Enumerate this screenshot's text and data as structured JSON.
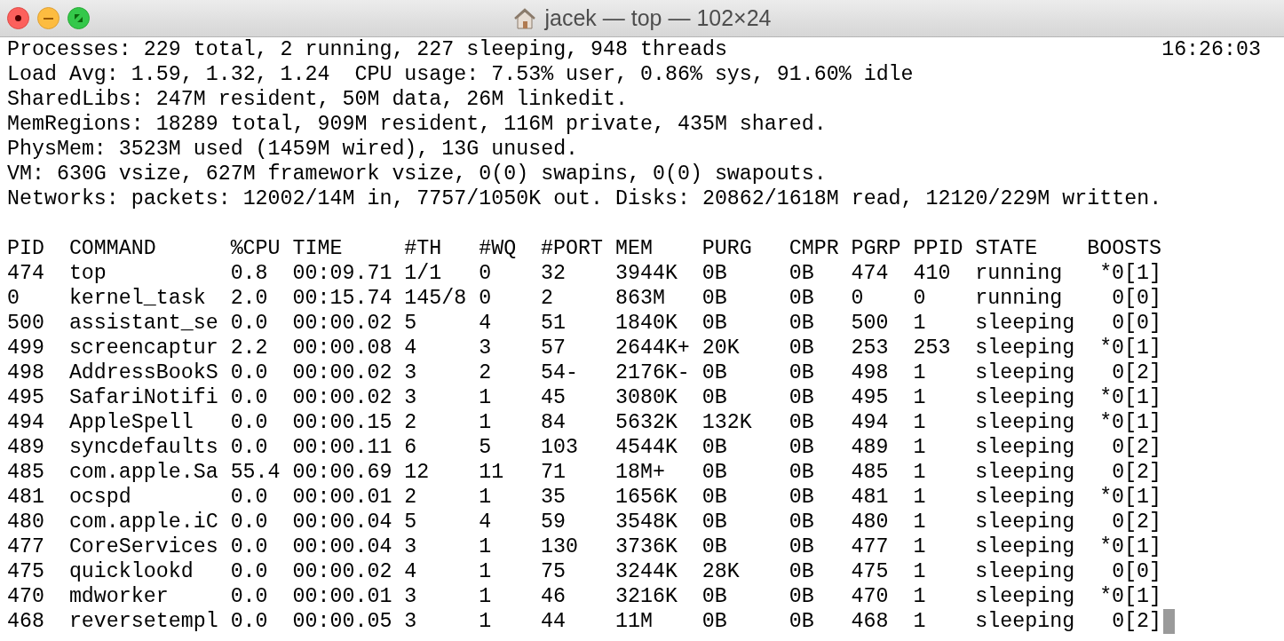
{
  "window": {
    "title": "jacek — top — 102×24"
  },
  "summary": [
    "Processes: 229 total, 2 running, 227 sleeping, 948 threads",
    "Load Avg: 1.59, 1.32, 1.24  CPU usage: 7.53% user, 0.86% sys, 91.60% idle",
    "SharedLibs: 247M resident, 50M data, 26M linkedit.",
    "MemRegions: 18289 total, 909M resident, 116M private, 435M shared.",
    "PhysMem: 3523M used (1459M wired), 13G unused.",
    "VM: 630G vsize, 627M framework vsize, 0(0) swapins, 0(0) swapouts.",
    "Networks: packets: 12002/14M in, 7757/1050K out. Disks: 20862/1618M read, 12120/229M written."
  ],
  "clock": "16:26:03",
  "table": {
    "columns": [
      "PID",
      "COMMAND",
      "%CPU",
      "TIME",
      "#TH",
      "#WQ",
      "#PORT",
      "MEM",
      "PURG",
      "CMPR",
      "PGRP",
      "PPID",
      "STATE",
      "BOOSTS"
    ],
    "rows": [
      [
        "474",
        "top",
        "0.8",
        "00:09.71",
        "1/1",
        "0",
        "32",
        "3944K",
        "0B",
        "0B",
        "474",
        "410",
        "running",
        "*0[1]"
      ],
      [
        "0",
        "kernel_task",
        "2.0",
        "00:15.74",
        "145/8",
        "0",
        "2",
        "863M",
        "0B",
        "0B",
        "0",
        "0",
        "running",
        "0[0]"
      ],
      [
        "500",
        "assistant_se",
        "0.0",
        "00:00.02",
        "5",
        "4",
        "51",
        "1840K",
        "0B",
        "0B",
        "500",
        "1",
        "sleeping",
        "0[0]"
      ],
      [
        "499",
        "screencaptur",
        "2.2",
        "00:00.08",
        "4",
        "3",
        "57",
        "2644K+",
        "20K",
        "0B",
        "253",
        "253",
        "sleeping",
        "*0[1]"
      ],
      [
        "498",
        "AddressBookS",
        "0.0",
        "00:00.02",
        "3",
        "2",
        "54-",
        "2176K-",
        "0B",
        "0B",
        "498",
        "1",
        "sleeping",
        "0[2]"
      ],
      [
        "495",
        "SafariNotifi",
        "0.0",
        "00:00.02",
        "3",
        "1",
        "45",
        "3080K",
        "0B",
        "0B",
        "495",
        "1",
        "sleeping",
        "*0[1]"
      ],
      [
        "494",
        "AppleSpell",
        "0.0",
        "00:00.15",
        "2",
        "1",
        "84",
        "5632K",
        "132K",
        "0B",
        "494",
        "1",
        "sleeping",
        "*0[1]"
      ],
      [
        "489",
        "syncdefaults",
        "0.0",
        "00:00.11",
        "6",
        "5",
        "103",
        "4544K",
        "0B",
        "0B",
        "489",
        "1",
        "sleeping",
        "0[2]"
      ],
      [
        "485",
        "com.apple.Sa",
        "55.4",
        "00:00.69",
        "12",
        "11",
        "71",
        "18M+",
        "0B",
        "0B",
        "485",
        "1",
        "sleeping",
        "0[2]"
      ],
      [
        "481",
        "ocspd",
        "0.0",
        "00:00.01",
        "2",
        "1",
        "35",
        "1656K",
        "0B",
        "0B",
        "481",
        "1",
        "sleeping",
        "*0[1]"
      ],
      [
        "480",
        "com.apple.iC",
        "0.0",
        "00:00.04",
        "5",
        "4",
        "59",
        "3548K",
        "0B",
        "0B",
        "480",
        "1",
        "sleeping",
        "0[2]"
      ],
      [
        "477",
        "CoreServices",
        "0.0",
        "00:00.04",
        "3",
        "1",
        "130",
        "3736K",
        "0B",
        "0B",
        "477",
        "1",
        "sleeping",
        "*0[1]"
      ],
      [
        "475",
        "quicklookd",
        "0.0",
        "00:00.02",
        "4",
        "1",
        "75",
        "3244K",
        "28K",
        "0B",
        "475",
        "1",
        "sleeping",
        "0[0]"
      ],
      [
        "470",
        "mdworker",
        "0.0",
        "00:00.01",
        "3",
        "1",
        "46",
        "3216K",
        "0B",
        "0B",
        "470",
        "1",
        "sleeping",
        "*0[1]"
      ],
      [
        "468",
        "reversetempl",
        "0.0",
        "00:00.05",
        "3",
        "1",
        "44",
        "11M",
        "0B",
        "0B",
        "468",
        "1",
        "sleeping",
        "0[2]"
      ]
    ]
  }
}
